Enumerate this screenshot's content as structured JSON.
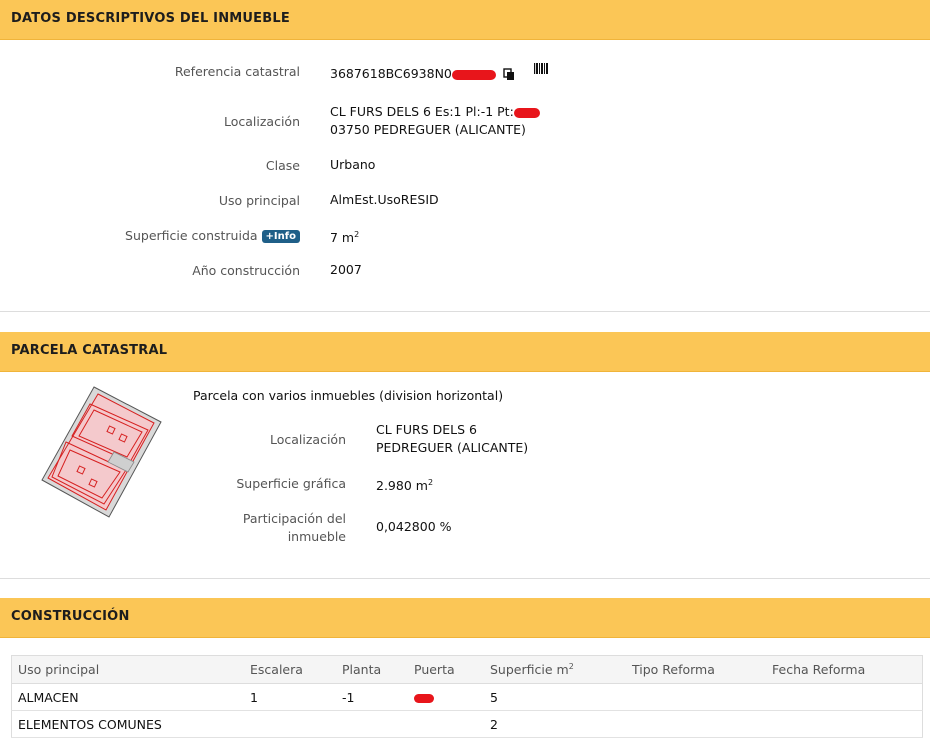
{
  "section_descriptive": {
    "title": "DATOS DESCRIPTIVOS DEL INMUEBLE",
    "ref_label": "Referencia catastral",
    "ref_value": "3687618BC6938N0",
    "loc_label": "Localización",
    "loc_line1": "CL FURS DELS 6 Es:1 Pl:-1 Pt:",
    "loc_line2": "03750 PEDREGUER (ALICANTE)",
    "clase_label": "Clase",
    "clase_value": "Urbano",
    "uso_label": "Uso principal",
    "uso_value": "AlmEst.UsoRESID",
    "sup_label": "Superficie construida",
    "info_badge": "+Info",
    "sup_value": "7 m",
    "sup_unit_sup": "2",
    "anio_label": "Año construcción",
    "anio_value": "2007"
  },
  "section_parcela": {
    "title": "PARCELA CATASTRAL",
    "desc": "Parcela con varios inmuebles (division horizontal)",
    "loc_label": "Localización",
    "loc_line1": "CL FURS DELS 6",
    "loc_line2": "PEDREGUER (ALICANTE)",
    "sup_label": "Superficie gráfica",
    "sup_value": "2.980 m",
    "sup_unit_sup": "2",
    "part_label_1": "Participación del",
    "part_label_2": "inmueble",
    "part_value": "0,042800 %"
  },
  "section_construccion": {
    "title": "CONSTRUCCIÓN",
    "headers": [
      "Uso principal",
      "Escalera",
      "Planta",
      "Puerta",
      "Superficie m",
      "Tipo Reforma",
      "Fecha Reforma"
    ],
    "header_sup": "2",
    "rows": [
      [
        "ALMACEN",
        "1",
        "-1",
        "",
        "5",
        "",
        ""
      ],
      [
        "ELEMENTOS COMUNES",
        "",
        "",
        "",
        "2",
        "",
        ""
      ]
    ]
  },
  "icons": {
    "copy": "copy-icon",
    "barcode": "barcode-icon",
    "redaction": "red-scribble"
  },
  "colors": {
    "header_bg": "#fbc656",
    "badge_bg": "#1f5f88",
    "redaction": "#e8151b",
    "parcel_fill": "#f4c9cc",
    "parcel_line": "#d62020"
  }
}
